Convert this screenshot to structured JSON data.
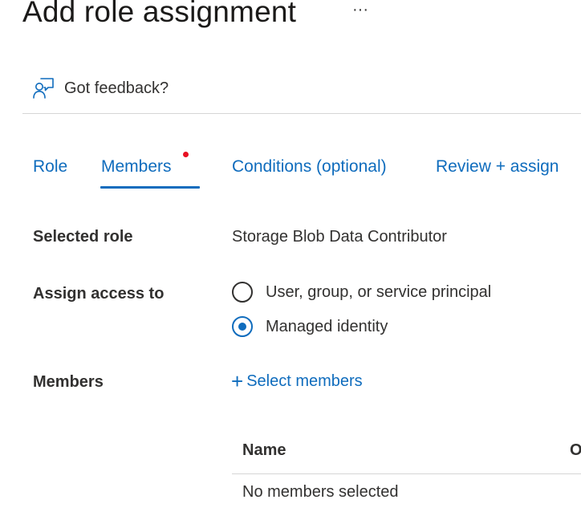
{
  "header": {
    "title": "Add role assignment",
    "more_label": "···",
    "more_icon": "ellipsis-icon"
  },
  "feedback": {
    "label": "Got feedback?",
    "icon": "feedback-person-icon"
  },
  "tabs": [
    {
      "label": "Role",
      "selected": false
    },
    {
      "label": "Members",
      "selected": true,
      "has_required_dot": true
    },
    {
      "label": "Conditions (optional)",
      "selected": false
    },
    {
      "label": "Review + assign",
      "selected": false
    }
  ],
  "form": {
    "selected_role": {
      "label": "Selected role",
      "value": "Storage Blob Data Contributor"
    },
    "assign_access": {
      "label": "Assign access to",
      "options": [
        {
          "label": "User, group, or service principal",
          "checked": false
        },
        {
          "label": "Managed identity",
          "checked": true
        }
      ]
    },
    "members": {
      "label": "Members",
      "action_label": "Select members",
      "action_icon": "plus-icon"
    }
  },
  "members_table": {
    "columns": [
      "Name",
      "O"
    ],
    "empty_text": "No members selected"
  },
  "colors": {
    "accent": "#0f6cbd",
    "required_dot": "#e81123",
    "text": "#323130",
    "divider": "#d6d6d6"
  }
}
